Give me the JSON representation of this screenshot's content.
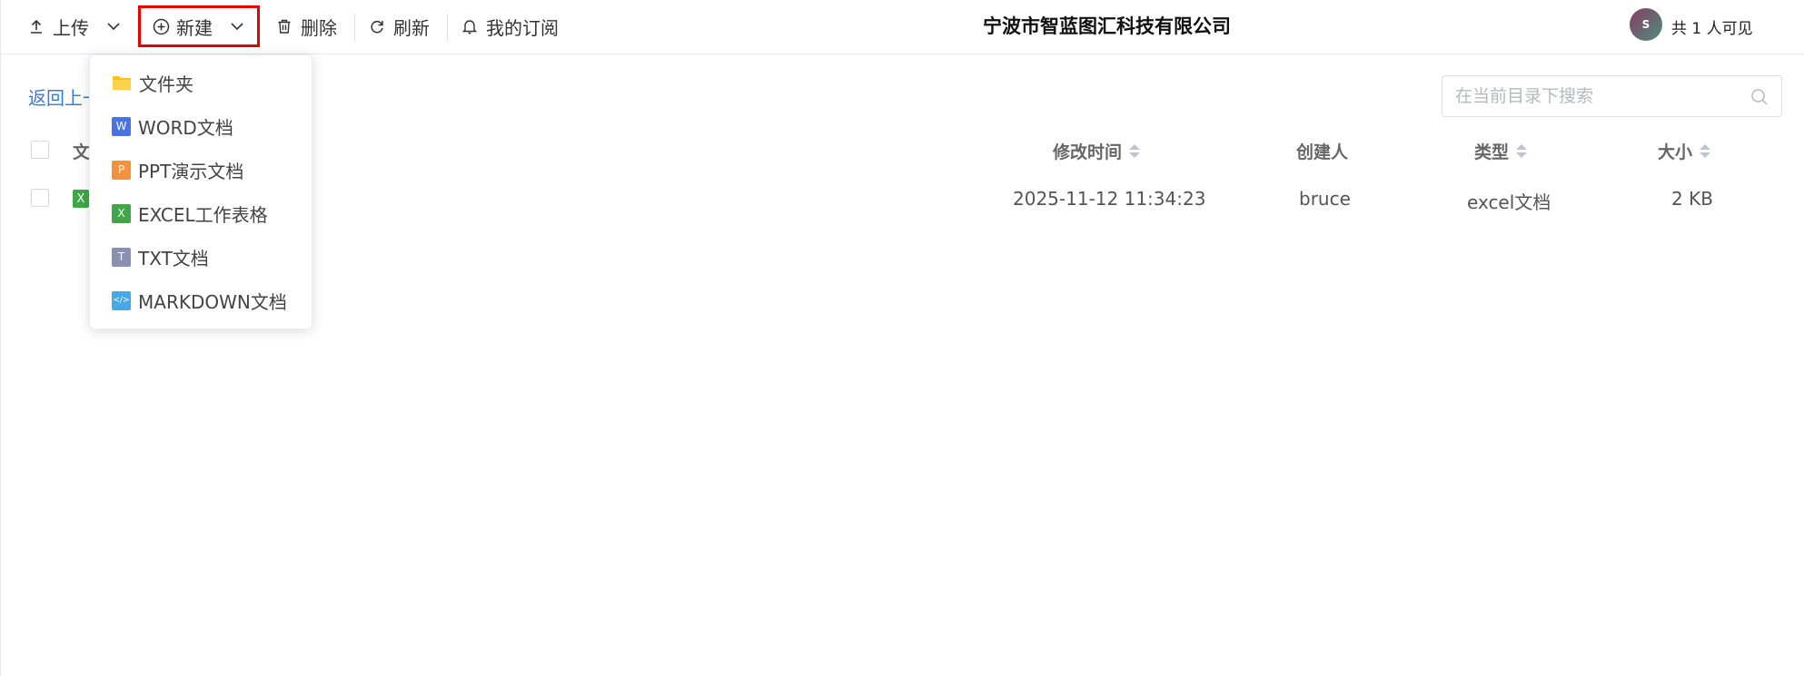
{
  "toolbar": {
    "upload_label": "上传",
    "new_label": "新建",
    "delete_label": "删除",
    "refresh_label": "刷新",
    "subscription_label": "我的订阅",
    "company_name": "宁波市智蓝图汇科技有限公司",
    "avatar_initial": "S",
    "visibility_text": "共 1 人可见"
  },
  "nav": {
    "back_label": "返回上一"
  },
  "search": {
    "placeholder": "在当前目录下搜索"
  },
  "table": {
    "columns": {
      "name": "文",
      "modified": "修改时间",
      "creator": "创建人",
      "type": "类型",
      "size": "大小"
    },
    "rows": [
      {
        "icon": "excel-file-icon",
        "icon_letter": "X",
        "modified": "2025-11-12 11:34:23",
        "creator": "bruce",
        "type": "excel文档",
        "size": "2 KB"
      }
    ]
  },
  "new_menu": {
    "items": [
      {
        "label": "文件夹",
        "icon": "folder-icon",
        "icon_letter": "",
        "color": "#f7c227"
      },
      {
        "label": "WORD文档",
        "icon": "word-doc-icon",
        "icon_letter": "W",
        "color": "#4a72e8"
      },
      {
        "label": "PPT演示文档",
        "icon": "ppt-doc-icon",
        "icon_letter": "P",
        "color": "#f5913b"
      },
      {
        "label": "EXCEL工作表格",
        "icon": "excel-doc-icon",
        "icon_letter": "X",
        "color": "#3fa748"
      },
      {
        "label": "TXT文档",
        "icon": "txt-doc-icon",
        "icon_letter": "T",
        "color": "#8a8fb3"
      },
      {
        "label": "MARKDOWN文档",
        "icon": "markdown-doc-icon",
        "icon_letter": "</>",
        "color": "#45a8e8"
      }
    ]
  },
  "colors": {
    "highlight_border": "#e60000",
    "link": "#3a7bd5"
  }
}
